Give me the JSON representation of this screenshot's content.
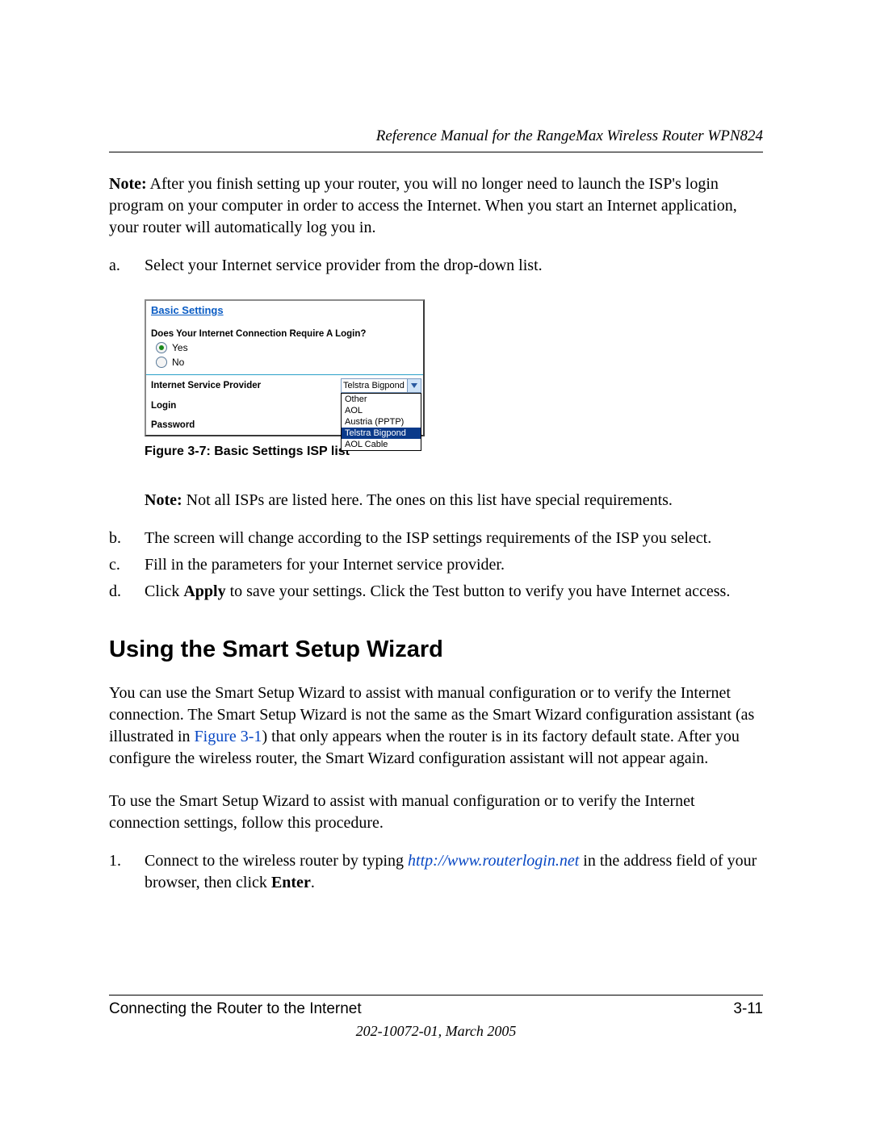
{
  "header": {
    "running_title": "Reference Manual for the RangeMax Wireless Router WPN824"
  },
  "note1": {
    "label": "Note:",
    "text": " After you finish setting up your router, you will no longer need to launch the ISP's login program on your computer in order to access the Internet. When you start an Internet application, your router will automatically log you in."
  },
  "list_a": {
    "a_marker": "a.",
    "a_text": "Select your Internet service provider from the drop-down list."
  },
  "figure": {
    "title": "Basic Settings",
    "question": "Does Your Internet Connection Require A Login?",
    "yes": "Yes",
    "no": "No",
    "isp_label": "Internet Service Provider",
    "login_label": "Login",
    "password_label": "Password",
    "selected": "Telstra Bigpond",
    "options": {
      "o0": "Other",
      "o1": "AOL",
      "o2": "Austria (PPTP)",
      "o3": "Telstra Bigpond",
      "o4": "AOL Cable"
    },
    "caption": "Figure 3-7:  Basic Settings ISP list"
  },
  "note2": {
    "label": "Note:",
    "text": " Not all ISPs are listed here. The ones on this list have special requirements."
  },
  "list_bcd": {
    "b_marker": "b.",
    "b_text": "The screen will change according to the ISP settings requirements of the ISP you select.",
    "c_marker": "c.",
    "c_text": "Fill in the parameters for your Internet service provider.",
    "d_marker": "d.",
    "d_pre": "Click ",
    "d_bold": "Apply",
    "d_post": " to save your settings. Click the Test button to verify you have Internet access."
  },
  "section": {
    "heading": "Using the Smart Setup Wizard",
    "p1a": "You can use the Smart Setup Wizard to assist with manual configuration or to verify the Internet connection. The Smart Setup Wizard is not the same as the Smart Wizard configuration assistant (as illustrated in ",
    "p1_link": "Figure 3-1",
    "p1b": ") that only appears when the router is in its factory default state. After you configure the wireless router, the Smart Wizard configuration assistant will not appear again.",
    "p2": "To use the Smart Setup Wizard to assist with manual configuration or to verify the Internet connection settings, follow this procedure.",
    "step1_marker": "1.",
    "step1_a": "Connect to the wireless router by typing ",
    "step1_url": "http://www.routerlogin.net",
    "step1_b": " in the address field of your browser, then click ",
    "step1_bold": "Enter",
    "step1_c": "."
  },
  "footer": {
    "left": "Connecting the Router to the Internet",
    "right": "3-11",
    "sub": "202-10072-01, March 2005"
  }
}
